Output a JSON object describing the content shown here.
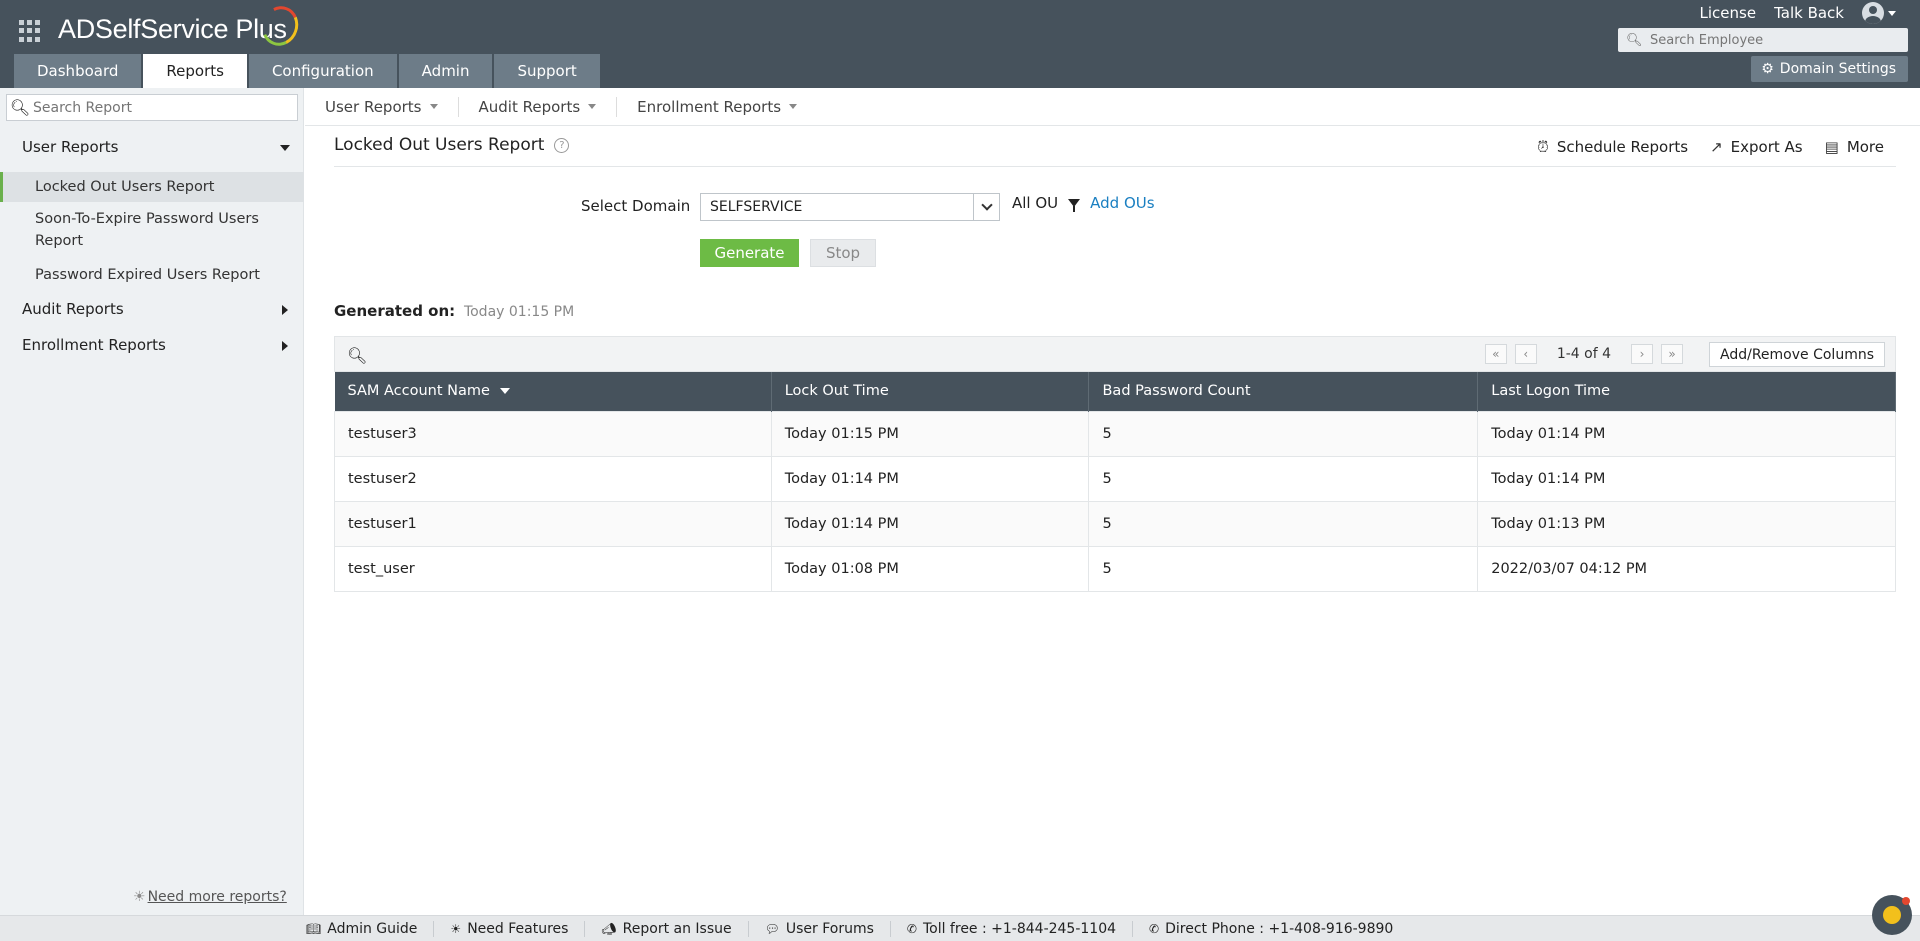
{
  "app": {
    "logo_text": "ADSelfService Plus"
  },
  "header": {
    "license": "License",
    "talk_back": "Talk Back",
    "employee_search_placeholder": "Search Employee",
    "tabs": [
      {
        "label": "Dashboard",
        "active": false
      },
      {
        "label": "Reports",
        "active": true
      },
      {
        "label": "Configuration",
        "active": false
      },
      {
        "label": "Admin",
        "active": false
      },
      {
        "label": "Support",
        "active": false
      }
    ],
    "domain_settings": "Domain Settings"
  },
  "sidebar": {
    "search_placeholder": "Search Report",
    "groups": {
      "user_reports": "User Reports",
      "audit_reports": "Audit Reports",
      "enrollment_reports": "Enrollment Reports"
    },
    "items": {
      "locked_out": "Locked Out Users Report",
      "soon_to_expire": "Soon-To-Expire Password Users Report",
      "password_expired": "Password Expired Users Report"
    },
    "need_more": "Need more reports?"
  },
  "subnav": {
    "user_reports": "User Reports",
    "audit_reports": "Audit Reports",
    "enrollment_reports": "Enrollment Reports"
  },
  "report": {
    "title": "Locked Out Users Report",
    "actions": {
      "schedule": "Schedule Reports",
      "export": "Export As",
      "more": "More"
    },
    "select_domain_label": "Select Domain",
    "domain_value": "SELFSERVICE",
    "ou_label": "All OU",
    "add_ous": "Add OUs",
    "generate": "Generate",
    "stop": "Stop",
    "generated_on_label": "Generated on:",
    "generated_on_value": "Today 01:15 PM"
  },
  "grid": {
    "pager_text": "1-4 of 4",
    "add_remove_columns": "Add/Remove Columns",
    "columns": [
      "SAM Account Name",
      "Lock Out Time",
      "Bad Password Count",
      "Last Logon Time"
    ],
    "rows": [
      [
        "testuser3",
        "Today 01:15 PM",
        "5",
        "Today 01:14 PM"
      ],
      [
        "testuser2",
        "Today 01:14 PM",
        "5",
        "Today 01:14 PM"
      ],
      [
        "testuser1",
        "Today 01:14 PM",
        "5",
        "Today 01:13 PM"
      ],
      [
        "test_user",
        "Today 01:08 PM",
        "5",
        "2022/03/07 04:12 PM"
      ]
    ]
  },
  "footer": {
    "admin_guide": "Admin Guide",
    "need_features": "Need Features",
    "report_issue": "Report an Issue",
    "user_forums": "User Forums",
    "toll_free": "Toll free : +1-844-245-1104",
    "direct_phone": "Direct Phone : +1-408-916-9890"
  },
  "colors": {
    "header_bg": "#46525c",
    "tab_bg": "#6d7c88",
    "generate_green": "#6dbb45",
    "link_blue": "#1a7fc1"
  }
}
